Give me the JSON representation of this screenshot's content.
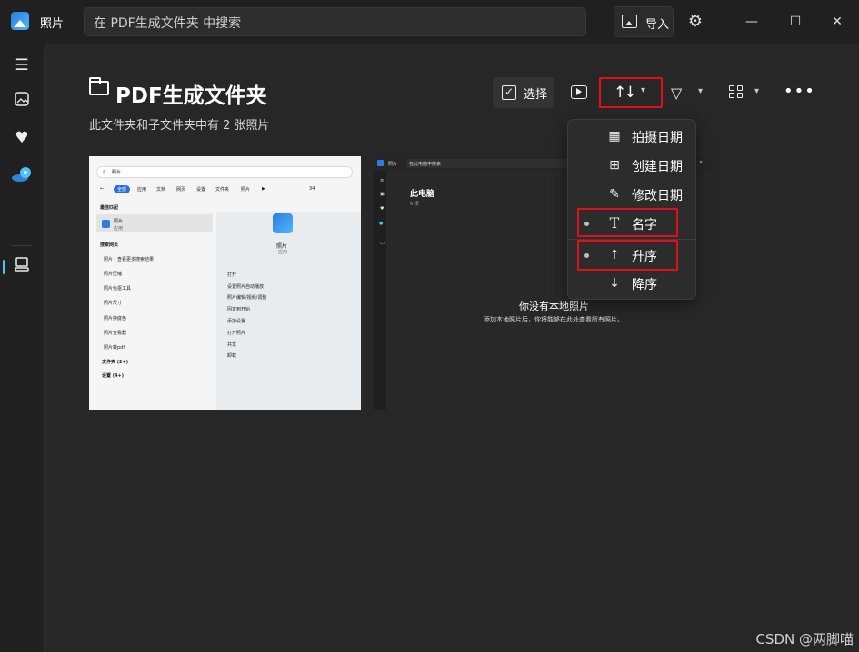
{
  "app": {
    "title": "照片"
  },
  "search": {
    "placeholder": "在 PDF生成文件夹 中搜索"
  },
  "header": {
    "import_label": "导入"
  },
  "page": {
    "title": "PDF生成文件夹",
    "subtitle": "此文件夹和子文件夹中有 2 张照片"
  },
  "toolbar": {
    "select_label": "选择"
  },
  "sort_menu": {
    "items": [
      {
        "label": "拍摄日期",
        "icon": "calendar-icon",
        "selected": false
      },
      {
        "label": "创建日期",
        "icon": "calendar-add-icon",
        "selected": false
      },
      {
        "label": "修改日期",
        "icon": "calendar-edit-icon",
        "selected": false
      },
      {
        "label": "名字",
        "icon": "text-icon",
        "selected": true
      },
      {
        "label": "升序",
        "icon": "arrow-up-icon",
        "selected": true
      },
      {
        "label": "降序",
        "icon": "arrow-down-icon",
        "selected": false
      }
    ]
  },
  "thumb1": {
    "search_text": "照片",
    "tabs": [
      "全部",
      "应用",
      "文档",
      "网页",
      "设置",
      "文件夹",
      "照片"
    ],
    "count": "34",
    "best_match_header": "最佳匹配",
    "best_match_title": "照片",
    "best_match_sub": "应用",
    "web_search_header": "搜索网页",
    "web_items": [
      "照片 - 查看更多搜索结果",
      "照片压缩",
      "照片免抠工具",
      "照片尺寸",
      "照片换底色",
      "照片查看器",
      "照片转pdf"
    ],
    "folders": "文件夹 (2+)",
    "settings": "设置 (4+)",
    "app_name": "照片",
    "app_type": "应用",
    "actions": [
      "打开",
      "设置照片自动播放",
      "照片编辑/视频/调整",
      "固定到开始",
      "添加设置",
      "打开照片",
      "共享",
      "卸载"
    ]
  },
  "thumb2": {
    "app_title": "照片",
    "search_text": "在此电脑中搜索",
    "folder_title": "此电脑",
    "folder_sub": "0 项",
    "empty_title": "你没有本地照片",
    "empty_sub": "添加本地照片后，你将能够在此处查看所有照片。"
  },
  "watermark": "CSDN @两脚喵",
  "colors": {
    "accent": "#4cc2ff",
    "highlight": "#e0101a",
    "background": "#202020"
  }
}
